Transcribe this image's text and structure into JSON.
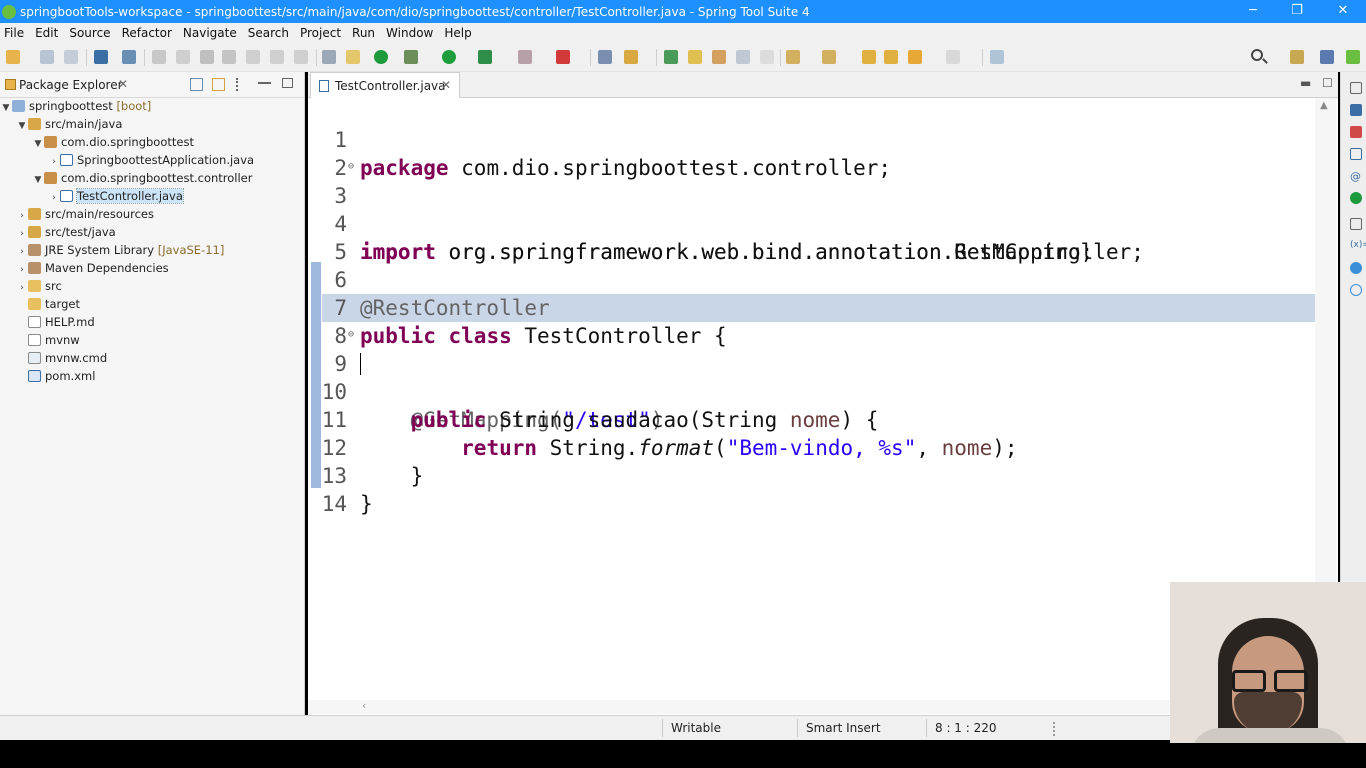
{
  "window": {
    "title": "springbootTools-workspace - springboottest/src/main/java/com/dio/springboottest/controller/TestController.java - Spring Tool Suite 4",
    "minimize": "─",
    "restore": "❐",
    "close": "✕"
  },
  "menu": [
    "File",
    "Edit",
    "Source",
    "Refactor",
    "Navigate",
    "Search",
    "Project",
    "Run",
    "Window",
    "Help"
  ],
  "package_explorer": {
    "title": "Package Explorer",
    "close": "✕",
    "tree": [
      {
        "label": "springboottest",
        "decor": "[boot]",
        "expanded": true
      },
      {
        "label": "src/main/java",
        "decor": "",
        "expanded": true
      },
      {
        "label": "com.dio.springboottest",
        "decor": "",
        "expanded": true
      },
      {
        "label": "SpringboottestApplication.java",
        "decor": "",
        "expanded": false
      },
      {
        "label": "com.dio.springboottest.controller",
        "decor": "",
        "expanded": true
      },
      {
        "label": "TestController.java",
        "decor": "",
        "expanded": false,
        "selected": true
      },
      {
        "label": "src/main/resources",
        "decor": "",
        "expanded": false
      },
      {
        "label": "src/test/java",
        "decor": "",
        "expanded": false
      },
      {
        "label": "JRE System Library",
        "decor": "[JavaSE-11]",
        "expanded": false
      },
      {
        "label": "Maven Dependencies",
        "decor": "",
        "expanded": false
      },
      {
        "label": "src",
        "decor": "",
        "expanded": false
      },
      {
        "label": "target",
        "decor": ""
      },
      {
        "label": "HELP.md",
        "decor": ""
      },
      {
        "label": "mvnw",
        "decor": ""
      },
      {
        "label": "mvnw.cmd",
        "decor": ""
      },
      {
        "label": "pom.xml",
        "decor": ""
      }
    ]
  },
  "editor": {
    "tab_label": "TestController.java",
    "tab_close": "✕",
    "line_numbers": [
      "1",
      "2",
      "3",
      "4",
      "5",
      "6",
      "7",
      "8",
      "9",
      "10",
      "11",
      "12",
      "13",
      "14"
    ],
    "code": {
      "l1_kw": "package",
      "l1_rest": " com.dio.springboottest.controller;",
      "l3_kw": "import",
      "l3_rest": " org.springframework.web.bind.annotation.GetMapping;",
      "l4_kw": "import",
      "l4_rest": " org.springframework.web.bind.annotation.RestController;",
      "l6_ann": "@RestController",
      "l7_kw1": "public",
      "l7_kw2": "class",
      "l7_rest": " TestController {",
      "l9_indent": "    ",
      "l9_ann": "@GetMapping(",
      "l9_str": "\"/test\"",
      "l9_close": ")",
      "l10_indent": "    ",
      "l10_kw": "public",
      "l10_type": " String saudacao(String ",
      "l10_param": "nome",
      "l10_end": ") {",
      "l11_indent": "        ",
      "l11_kw": "return",
      "l11_cls": " String.",
      "l11_method": "format",
      "l11_open": "(",
      "l11_str": "\"Bem-vindo, %s\"",
      "l11_comma": ", ",
      "l11_param": "nome",
      "l11_end": ");",
      "l12": "    }",
      "l13": "}"
    }
  },
  "statusbar": {
    "writable": "Writable",
    "insert_mode": "Smart Insert",
    "position": "8 : 1 : 220"
  },
  "colors": {
    "titlebar": "#1e90ff",
    "keyword": "#7f0055",
    "string": "#2a00ff",
    "annotation": "#646464",
    "parameter": "#6a3e3e",
    "current_line": "#c9d6e8"
  }
}
